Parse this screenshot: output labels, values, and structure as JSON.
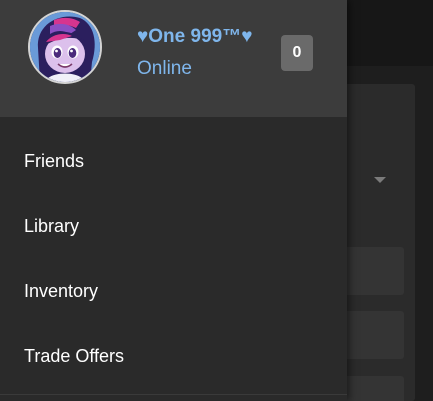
{
  "profile": {
    "username": "♥One 999™♥",
    "status": "Online",
    "notification_count": "0",
    "avatar_icon": "pony-avatar-icon"
  },
  "nav": {
    "items": [
      {
        "label": "Friends"
      },
      {
        "label": "Library"
      },
      {
        "label": "Inventory"
      },
      {
        "label": "Trade Offers"
      }
    ]
  },
  "colors": {
    "accent": "#7fb6ec",
    "drawer_bg": "#2a2a2a",
    "header_bg": "#3c3c3c",
    "badge_bg": "#6a6a6a"
  }
}
